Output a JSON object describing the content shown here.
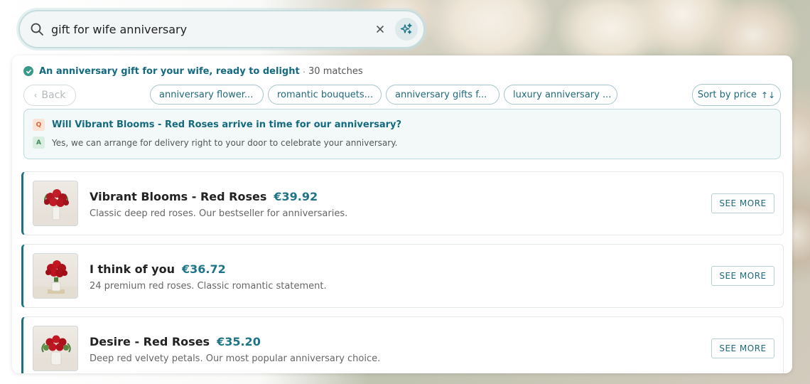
{
  "search": {
    "query": "gift for wife anniversary",
    "search_icon": "search-icon",
    "clear_icon": "close-icon",
    "ai_icon": "sparkle-icon"
  },
  "results": {
    "headline": "An anniversary gift for your wife, ready to delight",
    "separator": "·",
    "count": "30 matches"
  },
  "nav": {
    "back_label": "Back",
    "sort_label": "Sort by price",
    "sort_icon": "↑↓"
  },
  "chips": [
    {
      "label": "anniversary flower..."
    },
    {
      "label": "romantic bouquets..."
    },
    {
      "label": "anniversary gifts f..."
    },
    {
      "label": "luxury anniversary ..."
    }
  ],
  "qa": {
    "q_badge": "Q",
    "a_badge": "A",
    "question": "Will Vibrant Blooms - Red Roses arrive in time for our anniversary?",
    "answer": "Yes, we can arrange for delivery right to your door to celebrate your anniversary."
  },
  "products": [
    {
      "name": "Vibrant Blooms - Red Roses",
      "price": "€39.92",
      "description": "Classic deep red roses. Our bestseller for anniversaries.",
      "cta": "SEE MORE"
    },
    {
      "name": "I think of you",
      "price": "€36.72",
      "description": "24 premium red roses. Classic romantic statement.",
      "cta": "SEE MORE"
    },
    {
      "name": "Desire - Red Roses",
      "price": "€35.20",
      "description": "Deep red velvety petals. Our most popular anniversary choice.",
      "cta": "SEE MORE"
    }
  ],
  "colors": {
    "accent": "#1e6f7f",
    "price": "#1d7587",
    "success": "#3a9a8a"
  }
}
